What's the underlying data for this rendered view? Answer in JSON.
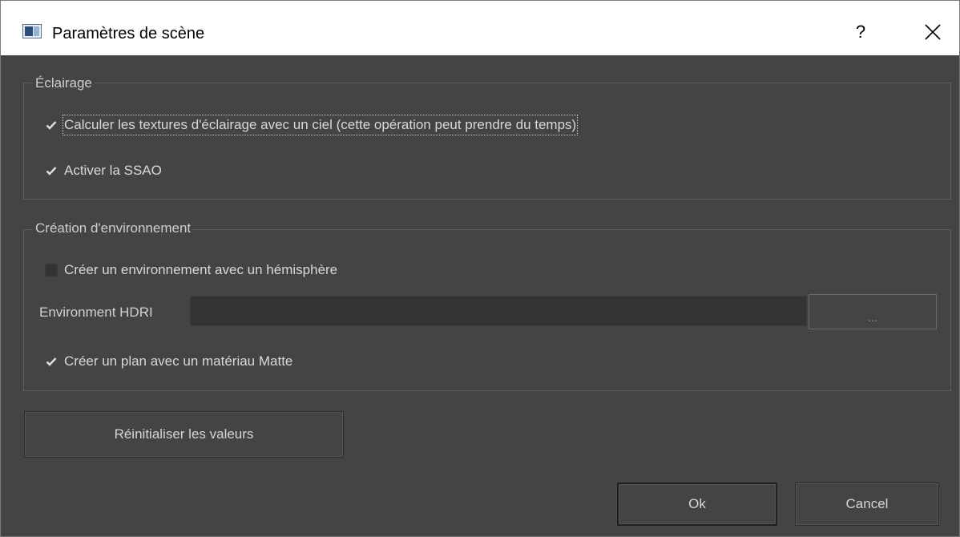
{
  "window": {
    "title": "Paramètres de scène",
    "help_label": "?",
    "close_icon": "close-icon"
  },
  "lighting": {
    "group_title": "Éclairage",
    "sky_lighting": {
      "label": "Calculer les textures d'éclairage avec un ciel (cette opération peut prendre du temps)",
      "checked": true
    },
    "ssao": {
      "label": "Activer la SSAO",
      "checked": true
    }
  },
  "environment": {
    "group_title": "Création d'environnement",
    "hemisphere": {
      "label": "Créer un environnement avec un hémisphère",
      "checked": false
    },
    "hdri_label": "Environment HDRI",
    "hdri_value": "",
    "browse_label": "...",
    "matte_plane": {
      "label": "Créer un plan avec un matériau Matte",
      "checked": true
    }
  },
  "actions": {
    "reset_label": "Réinitialiser les valeurs",
    "ok_label": "Ok",
    "cancel_label": "Cancel"
  },
  "colors": {
    "dialog_bg": "#444444",
    "titlebar_bg": "#ffffff",
    "text": "#d8d8d8"
  }
}
